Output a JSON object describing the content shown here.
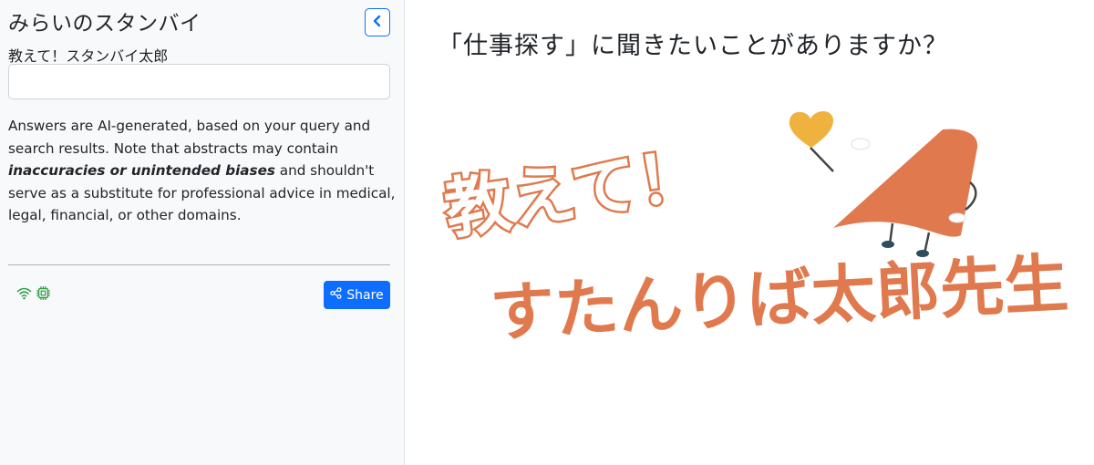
{
  "sidebar": {
    "app_title": "みらいのスタンバイ",
    "collapse_icon": "chevron-left-icon",
    "field_label": "教えて！スタンバイ太郎",
    "query_value": "",
    "disclaimer": {
      "part1": "Answers are AI-generated, based on your query and search results. Note that abstracts may contain ",
      "emphasis": "inaccuracies or unintended biases",
      "part2": " and shouldn't serve as a substitute for professional advice in medical, legal, financial, or other domains."
    },
    "status_icons": [
      "wifi-icon",
      "chip-icon"
    ],
    "share_label": "Share"
  },
  "main": {
    "prompt": "「仕事探す」に聞きたいことがありますか？",
    "hero_logo": {
      "line1": "教えて！",
      "line2": "すたんりば太郎先生"
    }
  },
  "colors": {
    "accent": "#0d6efd",
    "brand_orange": "#e07a4e",
    "heart_yellow": "#f0b23f",
    "status_green": "#2f9e44"
  }
}
